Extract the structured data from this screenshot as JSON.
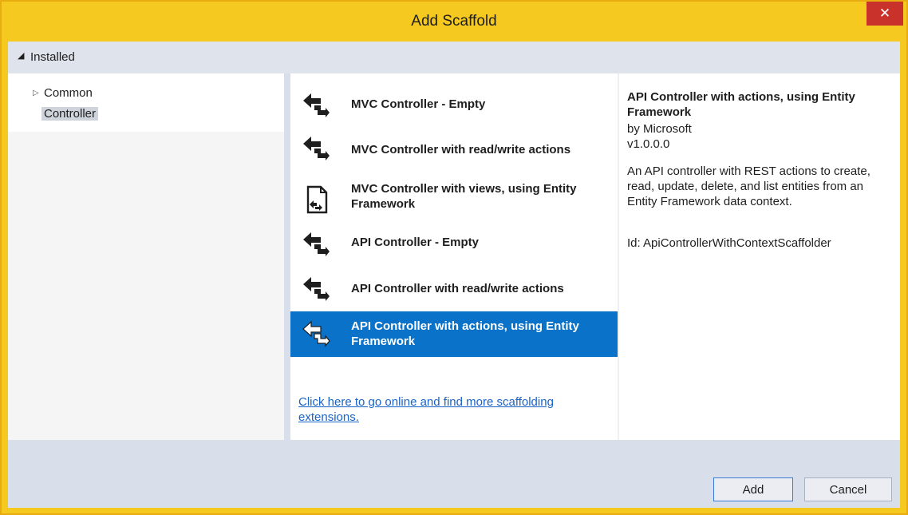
{
  "window": {
    "title": "Add Scaffold",
    "close_glyph": "✕"
  },
  "installed": {
    "label": "Installed",
    "arrow": "◢"
  },
  "tree": [
    {
      "label": "Common",
      "toggle": "▷"
    },
    {
      "label": "Controller"
    }
  ],
  "items": [
    {
      "label": "MVC Controller - Empty",
      "icon": "controller-icon"
    },
    {
      "label": "MVC Controller with read/write actions",
      "icon": "controller-icon"
    },
    {
      "label": "MVC Controller with views, using Entity Framework",
      "icon": "view-controller-icon"
    },
    {
      "label": "API Controller - Empty",
      "icon": "controller-icon"
    },
    {
      "label": "API Controller with read/write actions",
      "icon": "controller-icon"
    },
    {
      "label": "API Controller with actions, using Entity Framework",
      "icon": "controller-icon",
      "selected": true
    }
  ],
  "online_link": "Click here to go online and find more scaffolding extensions.",
  "detail": {
    "title": "API Controller with actions, using Entity Framework",
    "author": "by Microsoft",
    "version": "v1.0.0.0",
    "description": "An API controller with REST actions to create, read, update, delete, and list entities from an Entity Framework data context.",
    "id": "Id: ApiControllerWithContextScaffolder"
  },
  "buttons": {
    "add": "Add",
    "cancel": "Cancel"
  },
  "colors": {
    "frame": "#f5c91f",
    "selection": "#0a72c8",
    "close": "#c8322b"
  }
}
